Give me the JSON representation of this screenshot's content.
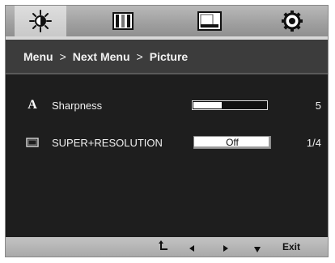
{
  "tabs": [
    {
      "icon": "brightness-icon",
      "active": true
    },
    {
      "icon": "color-bars-icon",
      "active": false
    },
    {
      "icon": "screen-display-icon",
      "active": false
    },
    {
      "icon": "settings-gear-icon",
      "active": false
    }
  ],
  "breadcrumb": {
    "item1": "Menu",
    "sep1": ">",
    "item2": "Next Menu",
    "sep2": ">",
    "item3": "Picture"
  },
  "settings": {
    "sharpness": {
      "icon_glyph": "A",
      "label": "Sharpness",
      "value": "5",
      "level": 0.38
    },
    "super_resolution": {
      "label": "SUPER+RESOLUTION",
      "state": "Off",
      "value": "1/4"
    }
  },
  "bottom_nav": {
    "return_glyph": "⮤",
    "left_glyph": "◂",
    "right_glyph": "▸",
    "down_glyph": "▾",
    "exit_label": "Exit"
  }
}
